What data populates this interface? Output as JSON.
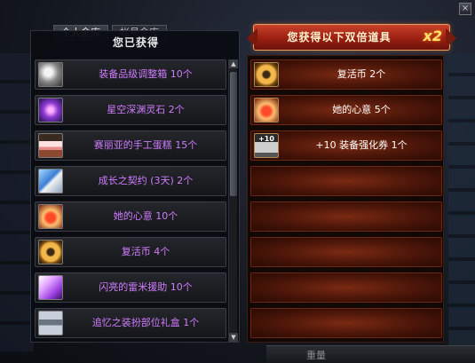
{
  "background": {
    "tabs": [
      "个人金库",
      "帐号金库"
    ],
    "bottom_text": "重量"
  },
  "left_panel": {
    "title": "您已获得",
    "items": [
      {
        "label": "装备品级调整箱 10个",
        "icon": "adjust-box-icon"
      },
      {
        "label": "星空深渊灵石 2个",
        "icon": "starry-stone-icon"
      },
      {
        "label": "赛丽亚的手工蛋糕 15个",
        "icon": "cake-icon"
      },
      {
        "label": "成长之契约 (3天) 2个",
        "icon": "contract-icon"
      },
      {
        "label": "她的心意 10个",
        "icon": "heart-icon"
      },
      {
        "label": "复活币 4个",
        "icon": "revive-coin-icon"
      },
      {
        "label": "闪亮的雷米援助 10个",
        "icon": "thunder-icon"
      },
      {
        "label": "追忆之装扮部位礼盒 1个",
        "icon": "chest-icon"
      }
    ]
  },
  "right_panel": {
    "banner": "您获得以下双倍道具",
    "multiplier": "x2",
    "items": [
      {
        "label": "复活币 2个",
        "icon": "revive-coin-icon"
      },
      {
        "label": "她的心意 5个",
        "icon": "heart-icon"
      },
      {
        "label": "+10 装备强化券 1个",
        "icon": "enhance-ticket-icon",
        "badge": "+10"
      }
    ],
    "empty_slots": 5
  },
  "colors": {
    "item_text_purple": "#d07cff",
    "banner_red": "#c9422a",
    "slot_red": "#7a2a12"
  }
}
